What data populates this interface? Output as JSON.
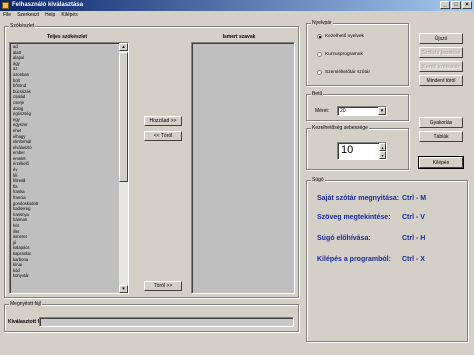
{
  "window": {
    "title": "Felhasználó kiválasztása"
  },
  "menu": [
    "File",
    "Szerkeszt",
    "Help",
    "Kilépés"
  ],
  "words_group": {
    "label": "Szókészlet",
    "all_header": "Teljes szókészlet",
    "known_header": "Ismert szavak",
    "all_words": [
      "ad",
      "alatt",
      "alapul",
      "ágy",
      "az",
      "azonban",
      "bolt",
      "bőrönd",
      "búcsúzás",
      "család",
      "cserje",
      "dolog",
      "egészség",
      "egy",
      "egyszer",
      "ehet",
      "elhagy",
      "elinformál",
      "elválasztó",
      "ember",
      "emelet",
      "érzékelő",
      "év",
      "fél",
      "félreáll",
      "fia",
      "franka",
      "francia",
      "gondoskodott",
      "hadsereg",
      "harisnya",
      "hármas",
      "hét",
      "illet",
      "ismeret",
      "jó",
      "kalapács",
      "kapcsolat",
      "karbona",
      "kínai",
      "kód",
      "könyvtár"
    ],
    "known_words": [],
    "add_button": "Hozzáad >>",
    "remove_button": "<< Töröl",
    "delete_button": "Töröl >>"
  },
  "options_group": {
    "label": "Nyelvpár",
    "radios": [
      {
        "label": "Kezelhető nyelvek",
        "selected": true
      },
      {
        "label": "Kurzusprogramok",
        "selected": false
      },
      {
        "label": "Szemléltetőtár szótár",
        "selected": false
      }
    ]
  },
  "right_buttons": {
    "new": "Újszó",
    "edit1": "Szólista kezelése",
    "edit2": "Kezdő szóközlés",
    "reset": "Mindent töröl",
    "practice": "Gyakorlás",
    "tables": "Táblák",
    "exit": "Kilépés"
  },
  "level_group": {
    "label": "Betű",
    "field_label": "Méret:",
    "value": "20"
  },
  "speed_group": {
    "label": "Kezelhetőség sebessége",
    "value": "10"
  },
  "help_group": {
    "label": "Súgó",
    "lines": [
      {
        "text": "Saját szótár megnyitása:",
        "key": "Ctrl - M"
      },
      {
        "text": "Szöveg megtekintése:",
        "key": "Ctrl - V"
      },
      {
        "text": "Súgó előhívása:",
        "key": "Ctrl - H"
      },
      {
        "text": "Kilépés a programból:",
        "key": "Ctrl - X"
      }
    ]
  },
  "progress_group": {
    "label": "Megnyitott fájl",
    "field_label": "Kiválasztott fájl:",
    "value": ""
  }
}
